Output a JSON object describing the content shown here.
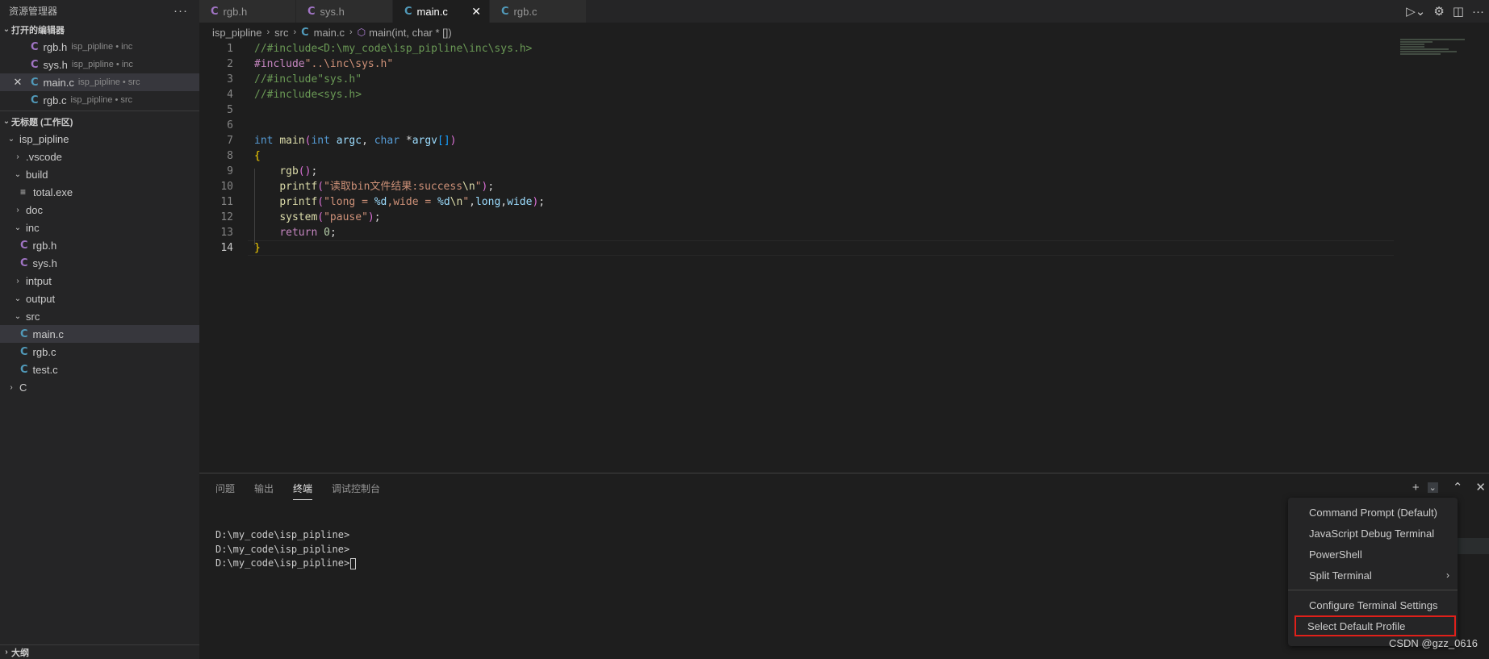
{
  "sidebar": {
    "title": "资源管理器",
    "more": "···",
    "open_editors_label": "打开的编辑器",
    "open_editors": [
      {
        "icon": "C",
        "name": "rgb.h",
        "path": "isp_pipline • inc",
        "kind": "header"
      },
      {
        "icon": "C",
        "name": "sys.h",
        "path": "isp_pipline • inc",
        "kind": "header"
      },
      {
        "icon": "C",
        "name": "main.c",
        "path": "isp_pipline • src",
        "kind": "source",
        "close": "✕"
      },
      {
        "icon": "C",
        "name": "rgb.c",
        "path": "isp_pipline • src",
        "kind": "source"
      }
    ],
    "workspace_label": "无标题 (工作区)",
    "tree": {
      "root": "isp_pipline",
      "vscode": ".vscode",
      "build": "build",
      "total_exe": "total.exe",
      "doc": "doc",
      "inc": "inc",
      "inc_rgb_h": "rgb.h",
      "inc_sys_h": "sys.h",
      "intput": "intput",
      "output": "output",
      "src": "src",
      "src_main_c": "main.c",
      "src_rgb_c": "rgb.c",
      "src_test_c": "test.c",
      "c_folder": "C"
    },
    "outline_label": "大纲",
    "c_glyph": "C"
  },
  "tabs": [
    {
      "label": "rgb.h",
      "icon": "C"
    },
    {
      "label": "sys.h",
      "icon": "C"
    },
    {
      "label": "main.c",
      "icon": "C",
      "close": "✕"
    },
    {
      "label": "rgb.c",
      "icon": "C"
    }
  ],
  "breadcrumb": {
    "project": "isp_pipline",
    "folder": "src",
    "file": "main.c",
    "symbol": "main(int, char * [])"
  },
  "editor": {
    "lines": [
      {
        "num": "1",
        "segments": [
          [
            "t-comment",
            "//#include<D:\\my_code\\isp_pipline\\inc\\sys.h>"
          ]
        ]
      },
      {
        "num": "2",
        "segments": [
          [
            "t-pre",
            "#include"
          ],
          [
            "t-str",
            "\"..\\inc\\sys.h\""
          ]
        ]
      },
      {
        "num": "3",
        "segments": [
          [
            "t-comment",
            "//#include\"sys.h\""
          ]
        ]
      },
      {
        "num": "4",
        "segments": [
          [
            "t-comment",
            "//#include<sys.h>"
          ]
        ]
      },
      {
        "num": "5",
        "segments": []
      },
      {
        "num": "6",
        "segments": []
      },
      {
        "num": "7",
        "segments": [
          [
            "t-kw",
            "int"
          ],
          [
            "t-plain",
            " "
          ],
          [
            "t-fn",
            "main"
          ],
          [
            "t-paren",
            "("
          ],
          [
            "t-kw",
            "int"
          ],
          [
            "t-plain",
            " "
          ],
          [
            "t-var",
            "argc"
          ],
          [
            "t-plain",
            ", "
          ],
          [
            "t-kw",
            "char"
          ],
          [
            "t-plain",
            " *"
          ],
          [
            "t-var",
            "argv"
          ],
          [
            "t-brk",
            "[]"
          ],
          [
            "t-paren",
            ")"
          ]
        ]
      },
      {
        "num": "8",
        "segments": [
          [
            "t-brace",
            "{"
          ]
        ]
      },
      {
        "num": "9",
        "segments": [
          [
            "t-plain",
            "    "
          ],
          [
            "t-fn",
            "rgb"
          ],
          [
            "t-paren",
            "()"
          ],
          [
            "t-plain",
            ";"
          ]
        ]
      },
      {
        "num": "10",
        "segments": [
          [
            "t-plain",
            "    "
          ],
          [
            "t-fn",
            "printf"
          ],
          [
            "t-paren",
            "("
          ],
          [
            "t-str",
            "\"读取bin文件结果:success"
          ],
          [
            "t-fn",
            "\\n"
          ],
          [
            "t-str",
            "\""
          ],
          [
            "t-paren",
            ")"
          ],
          [
            "t-plain",
            ";"
          ]
        ]
      },
      {
        "num": "11",
        "segments": [
          [
            "t-plain",
            "    "
          ],
          [
            "t-fn",
            "printf"
          ],
          [
            "t-paren",
            "("
          ],
          [
            "t-str",
            "\"long = "
          ],
          [
            "t-var",
            "%d"
          ],
          [
            "t-str",
            ",wide = "
          ],
          [
            "t-var",
            "%d"
          ],
          [
            "t-fn",
            "\\n"
          ],
          [
            "t-str",
            "\""
          ],
          [
            "t-plain",
            ","
          ],
          [
            "t-var",
            "long"
          ],
          [
            "t-plain",
            ","
          ],
          [
            "t-var",
            "wide"
          ],
          [
            "t-paren",
            ")"
          ],
          [
            "t-plain",
            ";"
          ]
        ]
      },
      {
        "num": "12",
        "segments": [
          [
            "t-plain",
            "    "
          ],
          [
            "t-fn",
            "system"
          ],
          [
            "t-paren",
            "("
          ],
          [
            "t-str",
            "\"pause\""
          ],
          [
            "t-paren",
            ")"
          ],
          [
            "t-plain",
            ";"
          ]
        ]
      },
      {
        "num": "13",
        "segments": [
          [
            "t-plain",
            "    "
          ],
          [
            "t-ctl",
            "return"
          ],
          [
            "t-plain",
            " "
          ],
          [
            "t-num",
            "0"
          ],
          [
            "t-plain",
            ";"
          ]
        ]
      },
      {
        "num": "14",
        "segments": [
          [
            "t-brace",
            "}"
          ]
        ],
        "current": true
      }
    ]
  },
  "panel": {
    "tabs": [
      "问题",
      "输出",
      "终端",
      "调试控制台"
    ],
    "active_tab": 2,
    "terminal_lines": [
      "D:\\my_code\\isp_pipline>",
      "D:\\my_code\\isp_pipline>",
      "D:\\my_code\\isp_pipline>"
    ]
  },
  "menu": {
    "items": [
      {
        "label": "Command Prompt (Default)"
      },
      {
        "label": "JavaScript Debug Terminal"
      },
      {
        "label": "PowerShell"
      },
      {
        "label": "Split Terminal",
        "submenu": true
      }
    ],
    "items2": [
      {
        "label": "Configure Terminal Settings"
      },
      {
        "label": "Select Default Profile",
        "highlighted": true
      }
    ]
  },
  "watermark": "CSDN @gzz_0616",
  "colors": {
    "background": "#1e1e1e",
    "sidebar": "#252526",
    "c_source_icon": "#519aba",
    "c_header_icon": "#a074c4",
    "highlight_box": "#e0201a"
  }
}
